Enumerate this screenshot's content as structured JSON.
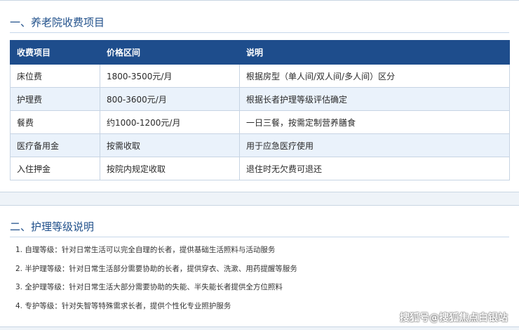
{
  "section1": {
    "title": "一、养老院收费项目",
    "table": {
      "headers": [
        "收费项目",
        "价格区间",
        "说明"
      ],
      "rows": [
        [
          "床位费",
          "1800-3500元/月",
          "根据房型（单人间/双人间/多人间）区分"
        ],
        [
          "护理费",
          "800-3600元/月",
          "根据长者护理等级评估确定"
        ],
        [
          "餐费",
          "约1000-1200元/月",
          "一日三餐，按需定制营养膳食"
        ],
        [
          "医疗备用金",
          "按需收取",
          "用于应急医疗使用"
        ],
        [
          "入住押金",
          "按院内规定收取",
          "退住时无欠费可退还"
        ]
      ]
    }
  },
  "section2": {
    "title": "二、护理等级说明",
    "items": [
      "1. 自理等级：针对日常生活可以完全自理的长者，提供基础生活照料与活动服务",
      "2. 半护理等级：针对日常生活部分需要协助的长者，提供穿衣、洗漱、用药提醒等服务",
      "3. 全护理等级：针对日常生活大部分需要协助的失能、半失能长者提供全方位照料",
      "4. 专护等级：针对失智等特殊需求长者，提供个性化专业照护服务"
    ]
  },
  "watermark": "搜狐号@搜狐焦点白银站"
}
